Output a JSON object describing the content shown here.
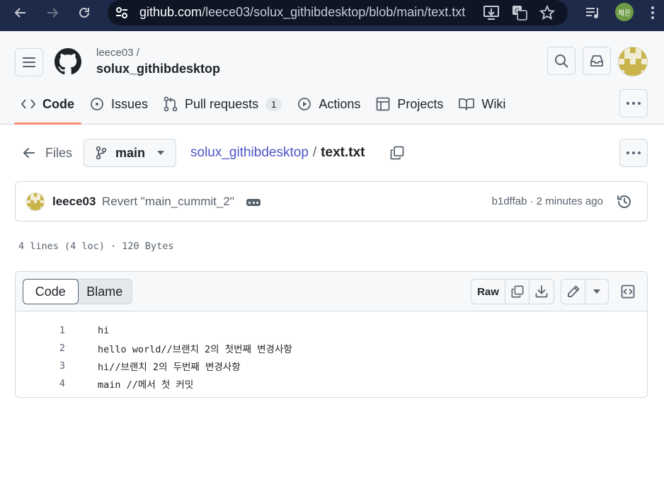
{
  "browser": {
    "url_host": "github.com",
    "url_path": "/leece03/solux_githibdesktop/blob/main/text.txt",
    "profile_initials": "채은"
  },
  "header": {
    "owner": "leece03 /",
    "repo": "solux_githibdesktop"
  },
  "tabs": [
    {
      "label": "Code",
      "icon": "code-icon",
      "active": true
    },
    {
      "label": "Issues",
      "icon": "issue-opened-icon"
    },
    {
      "label": "Pull requests",
      "icon": "git-pull-request-icon",
      "count": "1"
    },
    {
      "label": "Actions",
      "icon": "play-icon"
    },
    {
      "label": "Projects",
      "icon": "table-icon"
    },
    {
      "label": "Wiki",
      "icon": "book-icon"
    }
  ],
  "file_nav": {
    "files_label": "Files",
    "branch": "main",
    "path_repo": "solux_githibdesktop",
    "path_sep": "/",
    "path_file": "text.txt"
  },
  "commit": {
    "author": "leece03",
    "message": "Revert \"main_cummit_2\"",
    "meta": "b1dffab · 2 minutes ago"
  },
  "file_stats": "4 lines (4 loc) · 120 Bytes",
  "viewer": {
    "tab_code": "Code",
    "tab_blame": "Blame",
    "raw_label": "Raw"
  },
  "code_lines": [
    {
      "n": "1",
      "text": "hi"
    },
    {
      "n": "2",
      "text": "hello world//브랜치 2의 첫번째 변경사항"
    },
    {
      "n": "3",
      "text": "hi//브랜치 2의 두번째 변경사항"
    },
    {
      "n": "4",
      "text": "main //메서 첫 커밋"
    }
  ],
  "colors": {
    "browser_bar": "#1e2a4a",
    "tab_underline": "#fd8c73",
    "link": "#4d55c7"
  }
}
